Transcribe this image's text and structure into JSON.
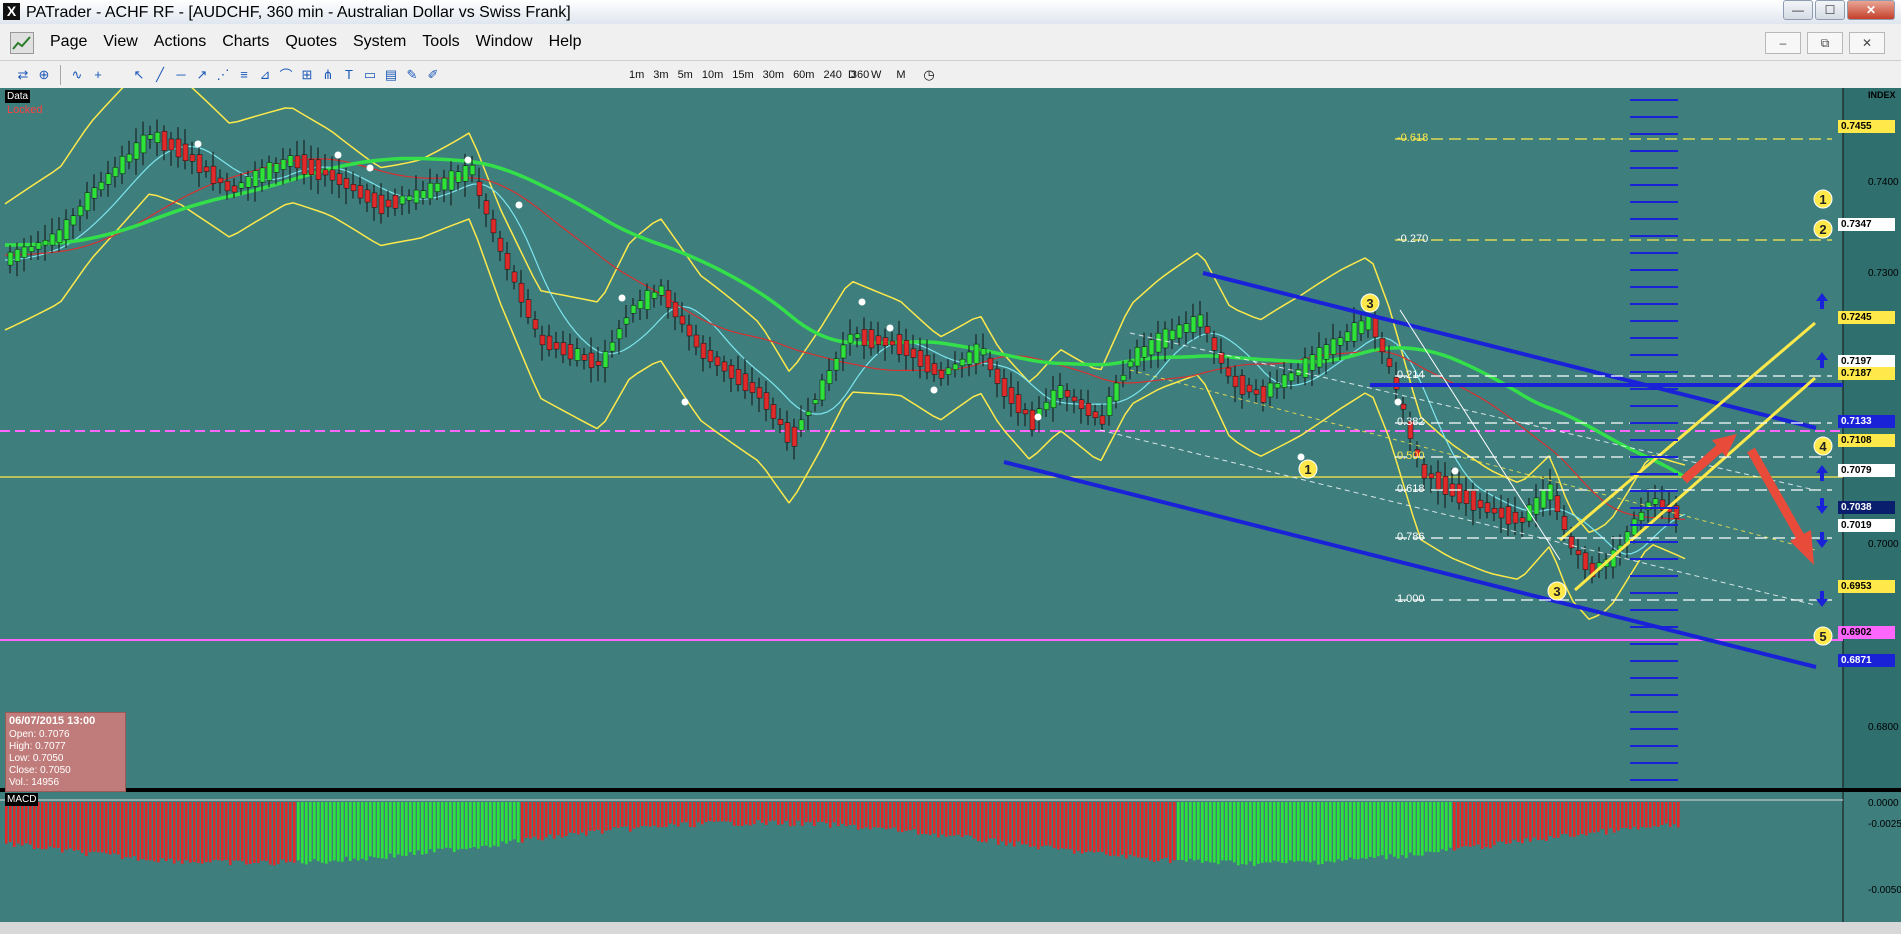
{
  "window": {
    "title": "PATrader - ACHF RF - [AUDCHF, 360 min - Australian Dollar vs Swiss Frank]",
    "app_icon": "X",
    "controls": [
      "minimize-icon",
      "maximize-icon",
      "close-icon"
    ]
  },
  "menu": [
    "Page",
    "View",
    "Actions",
    "Charts",
    "Quotes",
    "System",
    "Tools",
    "Window",
    "Help"
  ],
  "mdi_controls": [
    "–",
    "⧉",
    "✕"
  ],
  "toolbar": {
    "drawing_tools": [
      "pointer-icon",
      "crosshair-icon",
      "line-icon",
      "horizontal-line-icon",
      "trend-line-icon",
      "channel-icon",
      "fib-retracement-icon",
      "fib-fan-icon",
      "fib-arc-icon",
      "gann-icon",
      "pitchfork-icon",
      "text-icon",
      "rectangle-icon",
      "zone-icon",
      "brush-icon"
    ],
    "timeframes": [
      "1m",
      "3m",
      "5m",
      "10m",
      "15m",
      "30m",
      "60m",
      "240",
      "360"
    ],
    "periods": [
      "D",
      "W",
      "M"
    ]
  },
  "chart": {
    "data_label": "Data",
    "locked_label": "Locked",
    "macd_label": "MACD",
    "index_label": "INDEX",
    "colors": {
      "background": "#3e7f7e",
      "bull": "#2fe23a",
      "bear": "#e02a2a",
      "channel": "#1a22d8",
      "yellow": "#ffe94a",
      "ema_green": "#33e04a"
    },
    "price_axis": [
      "0.7400",
      "0.7300",
      "0.7000",
      "0.6800"
    ],
    "price_markers": [
      {
        "text": "0.7455",
        "color": "#ffe94a"
      },
      {
        "text": "0.7347",
        "color": "#ffffff"
      },
      {
        "text": "0.7245",
        "color": "#ffe94a"
      },
      {
        "text": "0.7197",
        "color": "#ffffff"
      },
      {
        "text": "0.7187",
        "color": "#ffe94a"
      },
      {
        "text": "0.7133",
        "color": "#1a22d8"
      },
      {
        "text": "0.7108",
        "color": "#ffe94a"
      },
      {
        "text": "0.7079",
        "color": "#ffffff"
      },
      {
        "text": "0.7038",
        "color": "#0a1e6e"
      },
      {
        "text": "0.7019",
        "color": "#ffffff"
      },
      {
        "text": "0.6953",
        "color": "#ffe94a"
      },
      {
        "text": "0.6902",
        "color": "#ff66ff"
      },
      {
        "text": "0.6871",
        "color": "#1a22d8"
      }
    ],
    "fib_levels": [
      "-0.618",
      "-0.270",
      "0.214",
      "0.382",
      "0.500",
      "0.618",
      "0.786",
      "1.000"
    ],
    "wave_labels": [
      "1",
      "2",
      "3",
      "4",
      "5",
      "1",
      "3"
    ],
    "macd_axis": [
      "0.0000",
      "-0.0025",
      "-0.0050"
    ]
  },
  "ohlc": {
    "date": "06/07/2015 13:00",
    "open": "Open: 0.7076",
    "high": "High: 0.7077",
    "low": "Low: 0.7050",
    "close": "Close: 0.7050",
    "vol": "Vol.: 14956"
  }
}
